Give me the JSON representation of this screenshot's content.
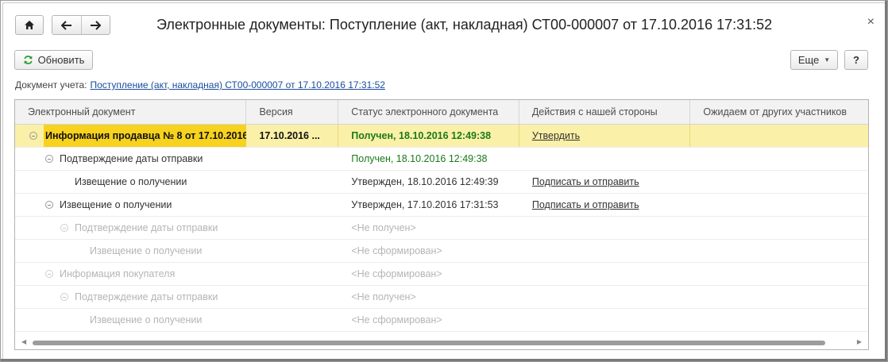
{
  "window": {
    "title": "Электронные документы: Поступление (акт, накладная) СТ00-000007 от 17.10.2016 17:31:52",
    "close_icon": "×"
  },
  "toolbar": {
    "refresh_label": "Обновить",
    "more_label": "Еще",
    "help_label": "?"
  },
  "doc_ref": {
    "label": "Документ учета:",
    "link": "Поступление (акт, накладная) СТ00-000007 от 17.10.2016 17:31:52"
  },
  "table": {
    "columns": [
      "Электронный документ",
      "Версия",
      "Статус электронного документа",
      "Действия с нашей стороны",
      "Ожидаем от других участников"
    ],
    "rows": [
      {
        "name": "Информация продавца № 8 от 17.10.2016",
        "version": "17.10.2016 ...",
        "status": "Получен, 18.10.2016 12:49:38",
        "action": "Утвердить",
        "waiting": ""
      },
      {
        "name": "Подтверждение даты отправки",
        "version": "",
        "status": "Получен, 18.10.2016 12:49:38",
        "action": "",
        "waiting": ""
      },
      {
        "name": "Извещение о получении",
        "version": "",
        "status": "Утвержден, 18.10.2016 12:49:39",
        "action": "Подписать и отправить",
        "waiting": ""
      },
      {
        "name": "Извещение о получении",
        "version": "",
        "status": "Утвержден, 17.10.2016 17:31:53",
        "action": "Подписать и отправить",
        "waiting": ""
      },
      {
        "name": "Подтверждение даты отправки",
        "version": "",
        "status": "<Не получен>",
        "action": "",
        "waiting": ""
      },
      {
        "name": "Извещение о получении",
        "version": "",
        "status": "<Не сформирован>",
        "action": "",
        "waiting": ""
      },
      {
        "name": "Информация покупателя",
        "version": "",
        "status": "<Не сформирован>",
        "action": "",
        "waiting": ""
      },
      {
        "name": "Подтверждение даты отправки",
        "version": "",
        "status": "<Не получен>",
        "action": "",
        "waiting": ""
      },
      {
        "name": "Извещение о получении",
        "version": "",
        "status": "<Не сформирован>",
        "action": "",
        "waiting": ""
      }
    ]
  },
  "colors": {
    "selected_row": "#fbf0a8",
    "selected_cell": "#f7d21f",
    "status_green": "#1a7a1a",
    "link_blue": "#1a4d9c"
  }
}
